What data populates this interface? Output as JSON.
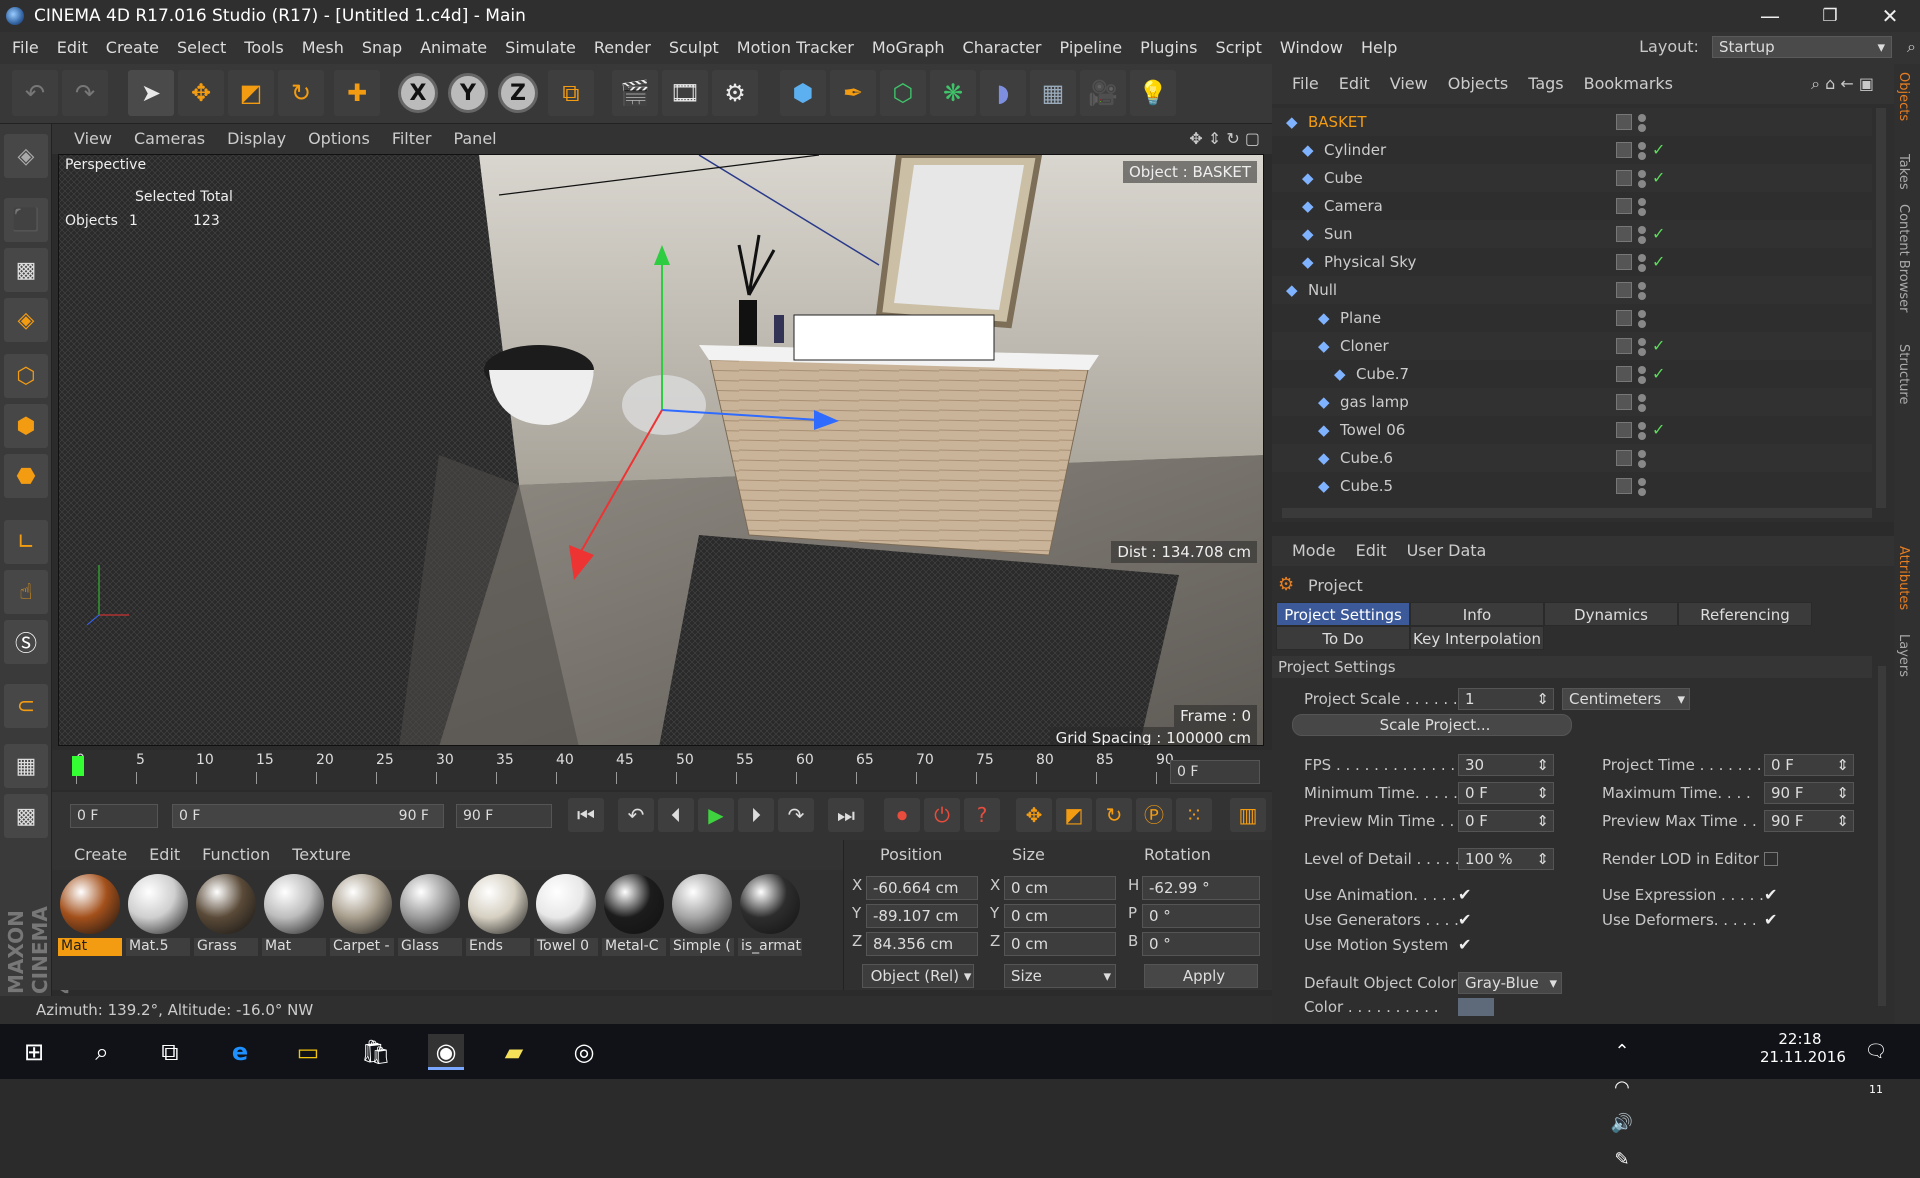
{
  "title": "CINEMA 4D R17.016 Studio (R17) - [Untitled 1.c4d] - Main",
  "window_controls": {
    "minimize": "—",
    "maximize": "❐",
    "close": "✕"
  },
  "menu": [
    "File",
    "Edit",
    "Create",
    "Select",
    "Tools",
    "Mesh",
    "Snap",
    "Animate",
    "Simulate",
    "Render",
    "Sculpt",
    "Motion Tracker",
    "MoGraph",
    "Character",
    "Pipeline",
    "Plugins",
    "Script",
    "Window",
    "Help"
  ],
  "layout": {
    "label": "Layout:",
    "value": "Startup"
  },
  "viewport": {
    "menu": [
      "View",
      "Cameras",
      "Display",
      "Options",
      "Filter",
      "Panel"
    ],
    "name": "Perspective",
    "selected_total_label": "Selected Total",
    "objects_label": "Objects",
    "objects_selected": "1",
    "objects_total": "123",
    "object_hud": "Object : BASKET",
    "dist": "Dist : 134.708 cm",
    "frame": "Frame : 0",
    "grid_spacing": "Grid Spacing : 100000 cm"
  },
  "timeline": {
    "ticks": [
      "0",
      "5",
      "10",
      "15",
      "20",
      "25",
      "30",
      "35",
      "40",
      "45",
      "50",
      "55",
      "60",
      "65",
      "70",
      "75",
      "80",
      "85",
      "90"
    ],
    "current": "0 F"
  },
  "transport": {
    "start": "0 F",
    "range_start": "0 F",
    "range_end": "90 F",
    "end": "90 F"
  },
  "materials": {
    "menu": [
      "Create",
      "Edit",
      "Function",
      "Texture"
    ],
    "items": [
      {
        "label": "Mat",
        "color": "#a3501b"
      },
      {
        "label": "Mat.5",
        "color": "#cfcfcf"
      },
      {
        "label": "Grass",
        "color": "#5a4a38"
      },
      {
        "label": "Mat",
        "color": "#bdbdbd"
      },
      {
        "label": "Carpet -",
        "color": "#a99f8e"
      },
      {
        "label": "Glass",
        "color": "#9c9c9c"
      },
      {
        "label": "Ends",
        "color": "#d6d0c2"
      },
      {
        "label": "Towel 0",
        "color": "#e8e8e8"
      },
      {
        "label": "Metal-C",
        "color": "#1c1c1c"
      },
      {
        "label": "Simple (",
        "color": "#a5a5a5"
      },
      {
        "label": "is_armat",
        "color": "#2d2d2d"
      }
    ]
  },
  "coords": {
    "headers": [
      "Position",
      "Size",
      "Rotation"
    ],
    "rows": [
      {
        "axis": "X",
        "pos": "-60.664 cm",
        "size_axis": "X",
        "size": "0 cm",
        "rot_axis": "H",
        "rot": "-62.99 °"
      },
      {
        "axis": "Y",
        "pos": "-89.107 cm",
        "size_axis": "Y",
        "size": "0 cm",
        "rot_axis": "P",
        "rot": "0 °"
      },
      {
        "axis": "Z",
        "pos": "84.356 cm",
        "size_axis": "Z",
        "size": "0 cm",
        "rot_axis": "B",
        "rot": "0 °"
      }
    ],
    "mode": "Object (Rel)",
    "size_mode": "Size",
    "apply": "Apply"
  },
  "status": "Azimuth: 139.2°, Altitude: -16.0°  NW",
  "objects": {
    "menu": [
      "File",
      "Edit",
      "View",
      "Objects",
      "Tags",
      "Bookmarks"
    ],
    "rows": [
      {
        "name": "BASKET",
        "indent": 0,
        "highlight": true,
        "check": false
      },
      {
        "name": "Cylinder",
        "indent": 1,
        "highlight": false,
        "check": true
      },
      {
        "name": "Cube",
        "indent": 1,
        "highlight": false,
        "check": true
      },
      {
        "name": "Camera",
        "indent": 1,
        "highlight": false,
        "check": false
      },
      {
        "name": "Sun",
        "indent": 1,
        "highlight": false,
        "check": true
      },
      {
        "name": "Physical Sky",
        "indent": 1,
        "highlight": false,
        "check": true
      },
      {
        "name": "Null",
        "indent": 0,
        "highlight": false,
        "check": false
      },
      {
        "name": "Plane",
        "indent": 2,
        "highlight": false,
        "check": false
      },
      {
        "name": "Cloner",
        "indent": 2,
        "highlight": false,
        "check": true
      },
      {
        "name": "Cube.7",
        "indent": 3,
        "highlight": false,
        "check": true
      },
      {
        "name": "gas lamp",
        "indent": 2,
        "highlight": false,
        "check": false
      },
      {
        "name": "Towel 06",
        "indent": 2,
        "highlight": false,
        "check": true
      },
      {
        "name": "Cube.6",
        "indent": 2,
        "highlight": false,
        "check": false
      },
      {
        "name": "Cube.5",
        "indent": 2,
        "highlight": false,
        "check": false
      }
    ]
  },
  "side_tabs": [
    "Objects",
    "Takes",
    "Content Browser",
    "Structure"
  ],
  "side_tabs2": [
    "Attributes",
    "Layers"
  ],
  "attributes": {
    "menu": [
      "Mode",
      "Edit",
      "User Data"
    ],
    "title": "Project",
    "tabs": [
      "Project Settings",
      "Info",
      "Dynamics",
      "Referencing",
      "To Do",
      "Key Interpolation"
    ],
    "section": "Project Settings",
    "project_scale_label": "Project Scale . . . . . .",
    "project_scale": "1",
    "unit": "Centimeters",
    "scale_button": "Scale Project...",
    "fps_label": "FPS . . . . . . . . . . . . .",
    "fps": "30",
    "project_time_label": "Project Time . . . . . . . .",
    "project_time": "0 F",
    "min_time_label": "Minimum Time. . . . .",
    "min_time": "0 F",
    "max_time_label": "Maximum Time. . . .",
    "max_time": "90 F",
    "preview_min_label": "Preview Min Time . .",
    "preview_min": "0 F",
    "preview_max_label": "Preview Max Time . .",
    "preview_max": "90 F",
    "lod_label": "Level of Detail . . . . .",
    "lod": "100 %",
    "render_lod_label": "Render LOD in Editor",
    "use_animation_label": "Use Animation. . . . .",
    "use_expression_label": "Use Expression . . . . .",
    "use_generators_label": "Use Generators . . . .",
    "use_deformers_label": "Use Deformers. . . . .",
    "use_motion_label": "Use Motion System",
    "default_color_label": "Default Object Color",
    "default_color": "Gray-Blue",
    "color_label": "Color . . . . . . . . . ."
  },
  "taskbar": {
    "time": "22:18",
    "date": "21.11.2016",
    "notif": "11"
  }
}
